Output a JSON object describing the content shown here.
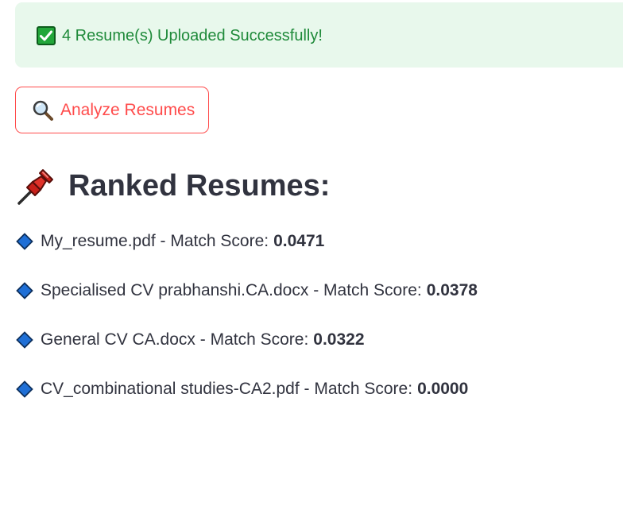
{
  "alert": {
    "icon": "check-mark-icon",
    "message": "4 Resume(s) Uploaded Successfully!",
    "text_color": "#1f8a3a",
    "background": "#e8f8ec"
  },
  "analyze_button": {
    "icon": "magnifier-icon",
    "label": "Analyze Resumes",
    "color": "#ff4b4b"
  },
  "results": {
    "heading_icon": "pushpin-icon",
    "heading": "Ranked Resumes:",
    "item_icon": "blue-diamond-icon",
    "items": [
      {
        "text": "My_resume.pdf - Match Score:",
        "score": "0.0471"
      },
      {
        "text": "Specialised CV prabhanshi.CA.docx - Match Score:",
        "score": "0.0378"
      },
      {
        "text": "General CV CA.docx - Match Score:",
        "score": "0.0322"
      },
      {
        "text": "CV_combinational studies-CA2.pdf - Match Score:",
        "score": "0.0000"
      }
    ]
  }
}
